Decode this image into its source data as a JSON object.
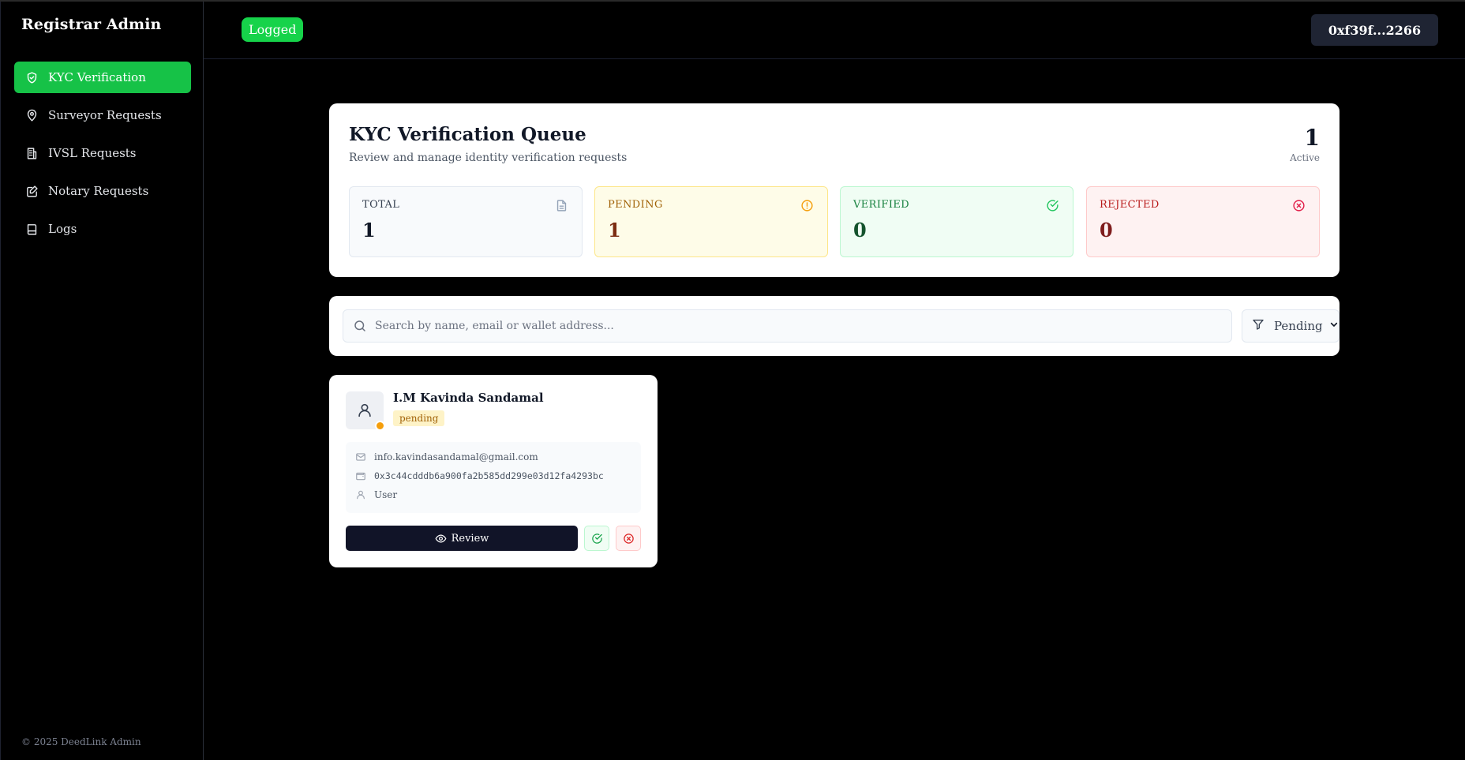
{
  "app": {
    "brand": "Registrar Admin",
    "footer": "© 2025 DeedLink Admin"
  },
  "sidebar": {
    "items": [
      {
        "label": "KYC Verification",
        "icon": "shield-check-icon",
        "active": true
      },
      {
        "label": "Surveyor Requests",
        "icon": "map-pin-icon",
        "active": false
      },
      {
        "label": "IVSL Requests",
        "icon": "building-icon",
        "active": false
      },
      {
        "label": "Notary Requests",
        "icon": "edit-document-icon",
        "active": false
      },
      {
        "label": "Logs",
        "icon": "book-icon",
        "active": false
      }
    ]
  },
  "header": {
    "status": "Logged",
    "wallet": "0xf39f...2266"
  },
  "queue": {
    "title": "KYC Verification Queue",
    "subtitle": "Review and manage identity verification requests",
    "active_count": "1",
    "active_label": "Active",
    "stats": [
      {
        "label": "TOTAL",
        "value": "1",
        "icon": "document-icon"
      },
      {
        "label": "PENDING",
        "value": "1",
        "icon": "alert-circle-icon"
      },
      {
        "label": "VERIFIED",
        "value": "0",
        "icon": "check-circle-icon"
      },
      {
        "label": "REJECTED",
        "value": "0",
        "icon": "x-circle-icon"
      }
    ]
  },
  "search": {
    "placeholder": "Search by name, email or wallet address...",
    "value": ""
  },
  "filter": {
    "selected": "Pending"
  },
  "requests": [
    {
      "name": "I.M Kavinda Sandamal",
      "status": "pending",
      "email": "info.kavindasandamal@gmail.com",
      "wallet": "0x3c44cdddb6a900fa2b585dd299e03d12fa4293bc",
      "role": "User",
      "review_label": "Review"
    }
  ],
  "colors": {
    "accent_green": "#16c247",
    "logged_green": "#16d34a",
    "pending_dot": "#f59e0b",
    "dark_button": "#111428"
  }
}
